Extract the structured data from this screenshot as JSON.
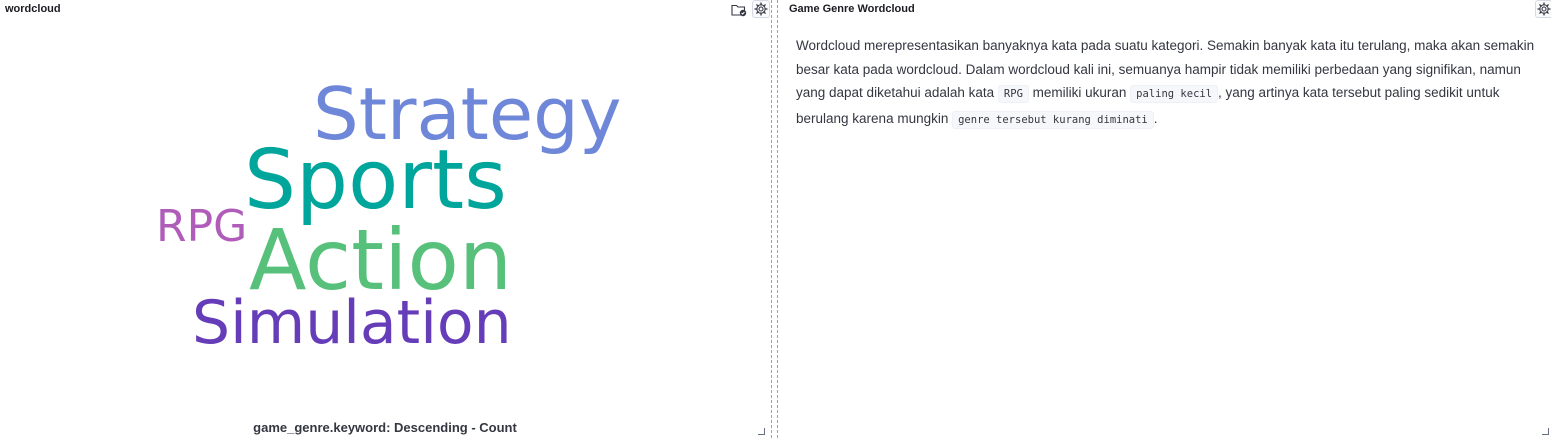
{
  "left_panel": {
    "title": "wordcloud",
    "legend_title": "game_genre.keyword: Descending - Count",
    "icons": [
      "folder-check-icon",
      "gear-icon"
    ]
  },
  "right_panel": {
    "title": "Game Genre Wordcloud",
    "icons": [
      "gear-icon"
    ],
    "markdown": {
      "text_1": "Wordcloud merepresentasikan banyaknya kata pada suatu kategori. Semakin banyak kata itu terulang, maka akan semakin besar kata pada wordcloud. Dalam wordcloud kali ini, semuanya hampir tidak memiliki perbedaan yang signifikan, namun yang dapat diketahui adalah kata ",
      "code_1": "RPG",
      "text_2": " memiliki ukuran ",
      "code_2": "paling kecil",
      "text_3": ", yang artinya kata tersebut paling sedikit untuk berulang karena mungkin ",
      "code_3": "genre tersebut kurang diminati",
      "text_4": "."
    }
  },
  "chart_data": {
    "type": "wordcloud",
    "words": [
      {
        "text": "Strategy",
        "color": "#6f87d8",
        "rank": 4
      },
      {
        "text": "Sports",
        "color": "#00a69b",
        "rank": 3
      },
      {
        "text": "RPG",
        "color": "#b05dba",
        "rank": 1
      },
      {
        "text": "Action",
        "color": "#57c17b",
        "rank": 5
      },
      {
        "text": "Simulation",
        "color": "#663db8",
        "rank": 2
      }
    ]
  }
}
